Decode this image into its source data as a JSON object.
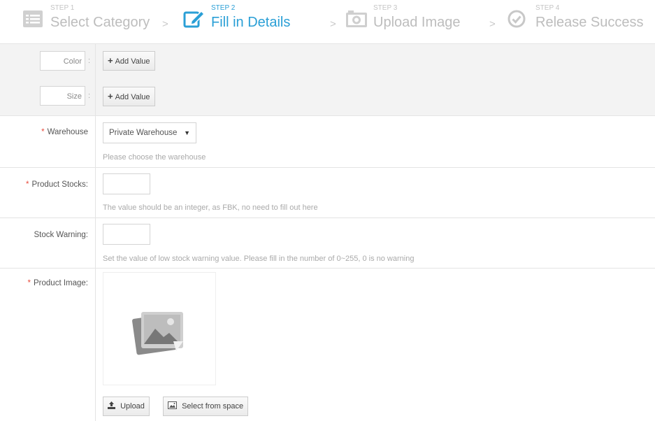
{
  "stepper": {
    "steps": [
      {
        "label": "STEP 1",
        "title": "Select Category",
        "icon": "list-card-icon",
        "active": false
      },
      {
        "label": "STEP 2",
        "title": "Fill in Details",
        "icon": "edit-icon",
        "active": true
      },
      {
        "label": "STEP 3",
        "title": "Upload Image",
        "icon": "camera-icon",
        "active": false
      },
      {
        "label": "STEP 4",
        "title": "Release Success",
        "icon": "check-circle-icon",
        "active": false
      }
    ],
    "separator": ">"
  },
  "form": {
    "color": {
      "input_value": "Color",
      "colon": ":",
      "button": "Add Value",
      "button_icon": "plus-icon"
    },
    "size": {
      "input_value": "Size",
      "colon": ":",
      "button": "Add Value",
      "button_icon": "plus-icon"
    },
    "warehouse": {
      "required_mark": "*",
      "label": "Warehouse",
      "selected": "Private Warehouse",
      "hint": "Please choose the warehouse"
    },
    "stocks": {
      "required_mark": "*",
      "label": "Product Stocks:",
      "value": "",
      "hint": "The value should be an integer, as FBK, no need to fill out here"
    },
    "warning": {
      "label": "Stock Warning:",
      "value": "",
      "hint": "Set the value of low stock warning value. Please fill in the number of 0~255, 0 is no warning"
    },
    "image": {
      "required_mark": "*",
      "label": "Product Image:",
      "placeholder_icon": "image-placeholder-icon",
      "upload_button": "Upload",
      "upload_icon": "upload-icon",
      "select_button": "Select from space",
      "select_icon": "picture-icon"
    }
  },
  "colors": {
    "accent": "#2a9fd6",
    "required": "#e84c3d",
    "muted": "#bdbdbd",
    "row_gray": "#f3f3f3"
  }
}
